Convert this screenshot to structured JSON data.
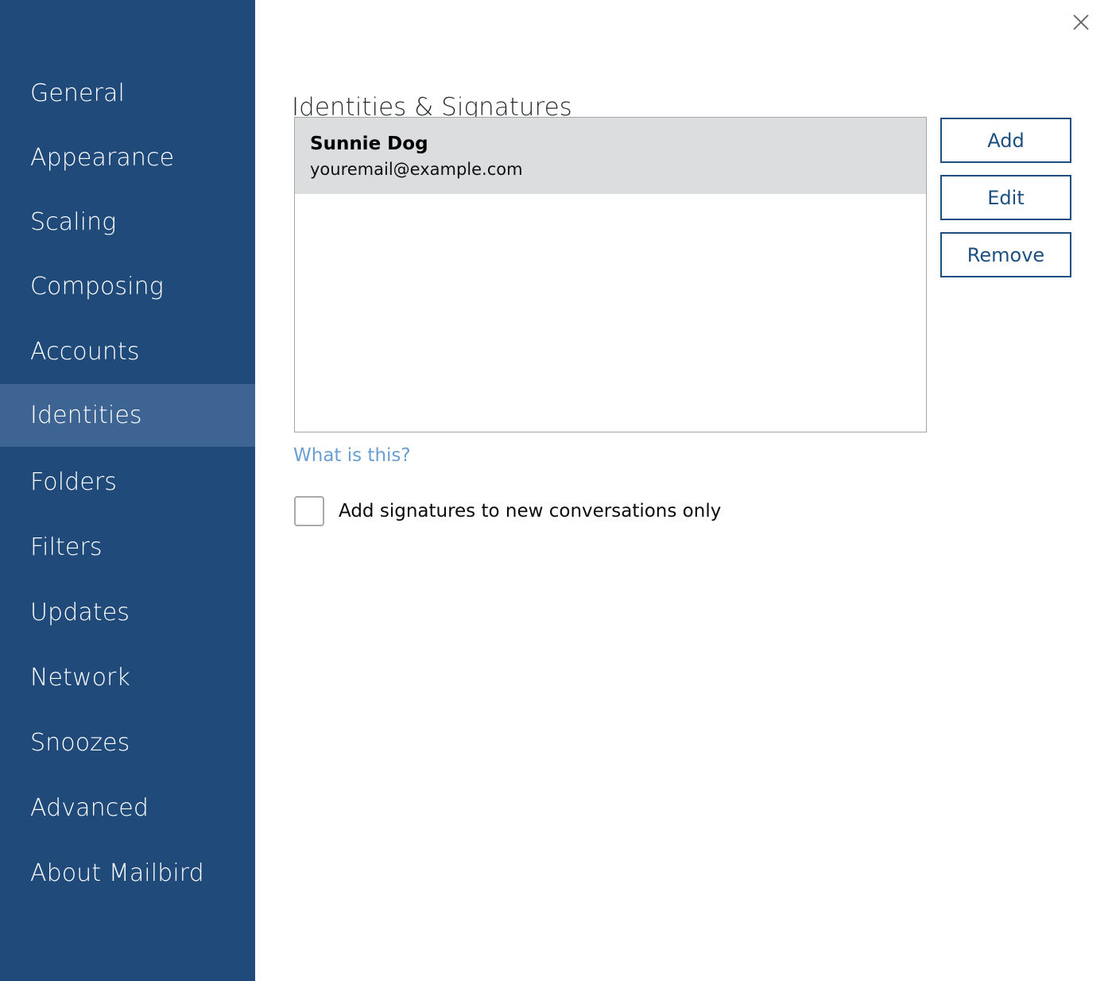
{
  "window": {
    "close_icon": "close-icon"
  },
  "sidebar": {
    "background_color": "#1f4a7a",
    "selected_color": "#3d6492",
    "items": [
      {
        "label": "General",
        "selected": false
      },
      {
        "label": "Appearance",
        "selected": false
      },
      {
        "label": "Scaling",
        "selected": false
      },
      {
        "label": "Composing",
        "selected": false
      },
      {
        "label": "Accounts",
        "selected": false
      },
      {
        "label": "Identities",
        "selected": true
      },
      {
        "label": "Folders",
        "selected": false
      },
      {
        "label": "Filters",
        "selected": false
      },
      {
        "label": "Updates",
        "selected": false
      },
      {
        "label": "Network",
        "selected": false
      },
      {
        "label": "Snoozes",
        "selected": false
      },
      {
        "label": "Advanced",
        "selected": false
      },
      {
        "label": "About Mailbird",
        "selected": false
      }
    ]
  },
  "main": {
    "title": "Identities & Signatures",
    "identities": [
      {
        "name": "Sunnie Dog",
        "email": "youremail@example.com",
        "selected": true
      }
    ],
    "buttons": [
      {
        "label": "Add",
        "name": "add-identity-button"
      },
      {
        "label": "Edit",
        "name": "edit-identity-button"
      },
      {
        "label": "Remove",
        "name": "remove-identity-button"
      }
    ],
    "help_link": "What is this?",
    "checkbox": {
      "label": "Add signatures to new conversations only",
      "checked": false
    },
    "accent_color": "#1d4f80",
    "link_color": "#6a9fd4",
    "selected_row_color": "#dcdddf"
  }
}
